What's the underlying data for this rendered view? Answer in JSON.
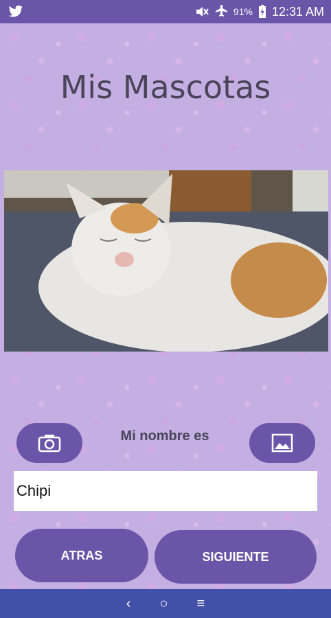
{
  "status_bar": {
    "app_icon": "twitter-icon",
    "icons": [
      "mute-icon",
      "airplane-icon"
    ],
    "battery_percent": "91%",
    "time": "12:31 AM"
  },
  "page": {
    "title": "Mis Mascotas"
  },
  "pet": {
    "photo_subject": "cat",
    "name_label": "Mi nombre es",
    "name_value": "Chipi"
  },
  "actions": {
    "camera_button_icon": "camera-icon",
    "gallery_button_icon": "image-icon",
    "back_label": "ATRAS",
    "next_label": "SIGUIENTE"
  },
  "nav_bar": {
    "back_glyph": "‹",
    "home_glyph": "○",
    "recents_glyph": "≡"
  },
  "colors": {
    "primary": "#6a55a8",
    "background": "#c4afe3",
    "nav_bar": "#4350a8"
  }
}
